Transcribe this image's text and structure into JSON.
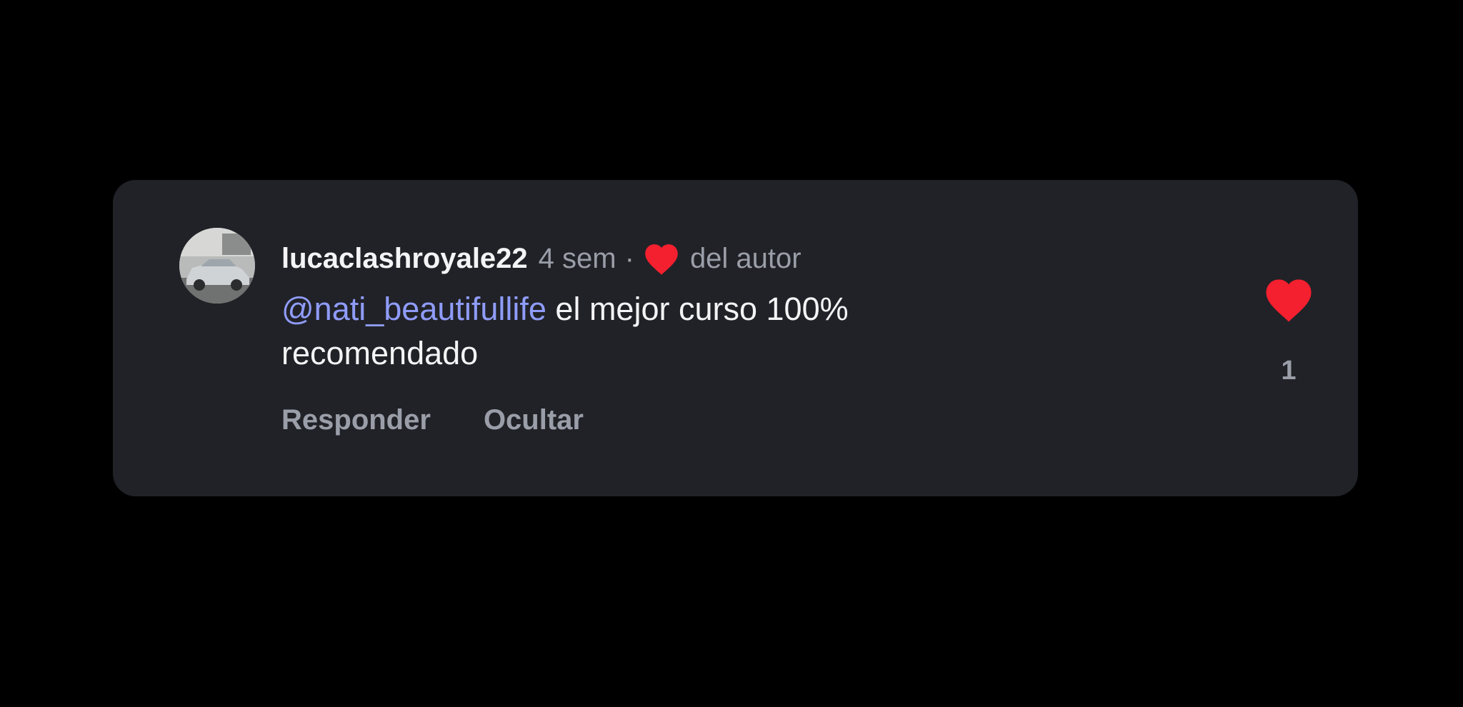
{
  "comment": {
    "username": "lucaclashroyale22",
    "time": "4 sem",
    "separator": "·",
    "author_like_label": "del autor",
    "mention": "@nati_beautifullife",
    "text": " el mejor curso 100% recomendado",
    "actions": {
      "reply_label": "Responder",
      "hide_label": "Ocultar"
    },
    "like_count": "1",
    "avatar_icon": "car-photo-avatar",
    "heart_icon": "heart-icon"
  },
  "colors": {
    "background": "#000000",
    "card": "#212227",
    "heart": "#f4202f",
    "mention": "#8f9cf9",
    "muted": "#9a9ea8",
    "text": "#f4f4f6"
  }
}
